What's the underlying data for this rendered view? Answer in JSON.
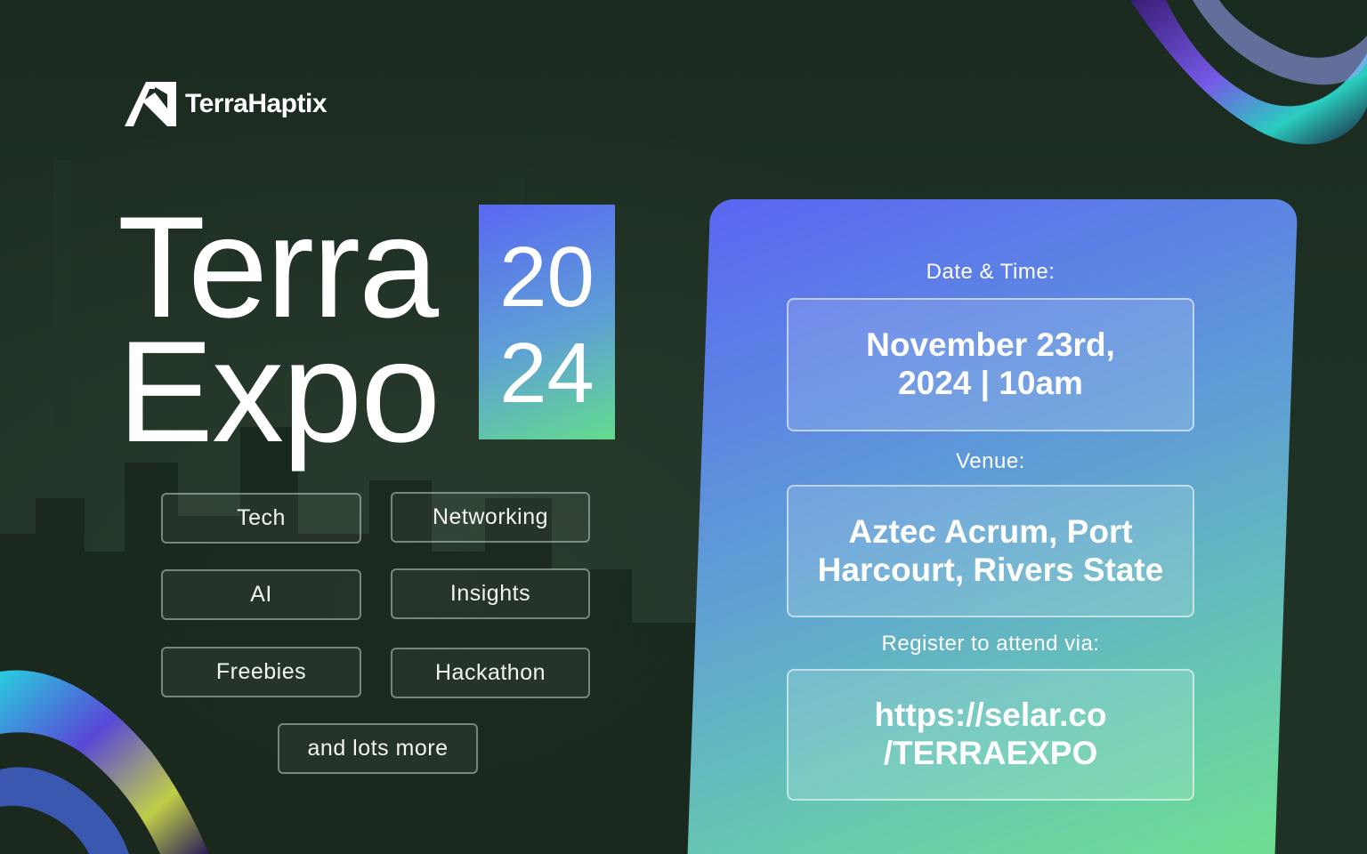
{
  "brand": {
    "name": "TerraHaptix"
  },
  "headline": {
    "line1": "Terra",
    "line2": "Expo",
    "year_top": "20",
    "year_bottom": "24"
  },
  "tags": [
    "Tech",
    "Networking",
    "AI",
    "Insights",
    "Freebies",
    "Hackathon",
    "and lots more"
  ],
  "details": {
    "date_label": "Date & Time:",
    "date_value": "November 23rd,\n2024 | 10am",
    "venue_label": "Venue:",
    "venue_value": "Aztec Acrum, Port\nHarcourt, Rivers State",
    "register_label": "Register to attend via:",
    "register_value": "https://selar.co\n/TERRAEXPO"
  },
  "colors": {
    "background": "#1f3124",
    "gradient_start": "#5a66f3",
    "gradient_end": "#6fe08e"
  }
}
